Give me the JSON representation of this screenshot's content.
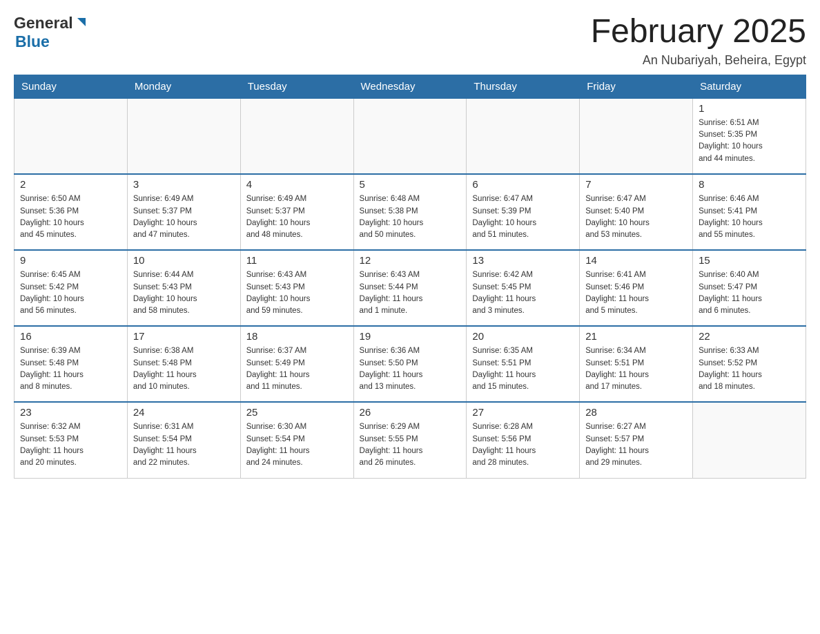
{
  "header": {
    "logo_general": "General",
    "logo_blue": "Blue",
    "title": "February 2025",
    "location": "An Nubariyah, Beheira, Egypt"
  },
  "days_of_week": [
    "Sunday",
    "Monday",
    "Tuesday",
    "Wednesday",
    "Thursday",
    "Friday",
    "Saturday"
  ],
  "weeks": [
    {
      "days": [
        {
          "num": "",
          "info": ""
        },
        {
          "num": "",
          "info": ""
        },
        {
          "num": "",
          "info": ""
        },
        {
          "num": "",
          "info": ""
        },
        {
          "num": "",
          "info": ""
        },
        {
          "num": "",
          "info": ""
        },
        {
          "num": "1",
          "info": "Sunrise: 6:51 AM\nSunset: 5:35 PM\nDaylight: 10 hours\nand 44 minutes."
        }
      ]
    },
    {
      "days": [
        {
          "num": "2",
          "info": "Sunrise: 6:50 AM\nSunset: 5:36 PM\nDaylight: 10 hours\nand 45 minutes."
        },
        {
          "num": "3",
          "info": "Sunrise: 6:49 AM\nSunset: 5:37 PM\nDaylight: 10 hours\nand 47 minutes."
        },
        {
          "num": "4",
          "info": "Sunrise: 6:49 AM\nSunset: 5:37 PM\nDaylight: 10 hours\nand 48 minutes."
        },
        {
          "num": "5",
          "info": "Sunrise: 6:48 AM\nSunset: 5:38 PM\nDaylight: 10 hours\nand 50 minutes."
        },
        {
          "num": "6",
          "info": "Sunrise: 6:47 AM\nSunset: 5:39 PM\nDaylight: 10 hours\nand 51 minutes."
        },
        {
          "num": "7",
          "info": "Sunrise: 6:47 AM\nSunset: 5:40 PM\nDaylight: 10 hours\nand 53 minutes."
        },
        {
          "num": "8",
          "info": "Sunrise: 6:46 AM\nSunset: 5:41 PM\nDaylight: 10 hours\nand 55 minutes."
        }
      ]
    },
    {
      "days": [
        {
          "num": "9",
          "info": "Sunrise: 6:45 AM\nSunset: 5:42 PM\nDaylight: 10 hours\nand 56 minutes."
        },
        {
          "num": "10",
          "info": "Sunrise: 6:44 AM\nSunset: 5:43 PM\nDaylight: 10 hours\nand 58 minutes."
        },
        {
          "num": "11",
          "info": "Sunrise: 6:43 AM\nSunset: 5:43 PM\nDaylight: 10 hours\nand 59 minutes."
        },
        {
          "num": "12",
          "info": "Sunrise: 6:43 AM\nSunset: 5:44 PM\nDaylight: 11 hours\nand 1 minute."
        },
        {
          "num": "13",
          "info": "Sunrise: 6:42 AM\nSunset: 5:45 PM\nDaylight: 11 hours\nand 3 minutes."
        },
        {
          "num": "14",
          "info": "Sunrise: 6:41 AM\nSunset: 5:46 PM\nDaylight: 11 hours\nand 5 minutes."
        },
        {
          "num": "15",
          "info": "Sunrise: 6:40 AM\nSunset: 5:47 PM\nDaylight: 11 hours\nand 6 minutes."
        }
      ]
    },
    {
      "days": [
        {
          "num": "16",
          "info": "Sunrise: 6:39 AM\nSunset: 5:48 PM\nDaylight: 11 hours\nand 8 minutes."
        },
        {
          "num": "17",
          "info": "Sunrise: 6:38 AM\nSunset: 5:48 PM\nDaylight: 11 hours\nand 10 minutes."
        },
        {
          "num": "18",
          "info": "Sunrise: 6:37 AM\nSunset: 5:49 PM\nDaylight: 11 hours\nand 11 minutes."
        },
        {
          "num": "19",
          "info": "Sunrise: 6:36 AM\nSunset: 5:50 PM\nDaylight: 11 hours\nand 13 minutes."
        },
        {
          "num": "20",
          "info": "Sunrise: 6:35 AM\nSunset: 5:51 PM\nDaylight: 11 hours\nand 15 minutes."
        },
        {
          "num": "21",
          "info": "Sunrise: 6:34 AM\nSunset: 5:51 PM\nDaylight: 11 hours\nand 17 minutes."
        },
        {
          "num": "22",
          "info": "Sunrise: 6:33 AM\nSunset: 5:52 PM\nDaylight: 11 hours\nand 18 minutes."
        }
      ]
    },
    {
      "days": [
        {
          "num": "23",
          "info": "Sunrise: 6:32 AM\nSunset: 5:53 PM\nDaylight: 11 hours\nand 20 minutes."
        },
        {
          "num": "24",
          "info": "Sunrise: 6:31 AM\nSunset: 5:54 PM\nDaylight: 11 hours\nand 22 minutes."
        },
        {
          "num": "25",
          "info": "Sunrise: 6:30 AM\nSunset: 5:54 PM\nDaylight: 11 hours\nand 24 minutes."
        },
        {
          "num": "26",
          "info": "Sunrise: 6:29 AM\nSunset: 5:55 PM\nDaylight: 11 hours\nand 26 minutes."
        },
        {
          "num": "27",
          "info": "Sunrise: 6:28 AM\nSunset: 5:56 PM\nDaylight: 11 hours\nand 28 minutes."
        },
        {
          "num": "28",
          "info": "Sunrise: 6:27 AM\nSunset: 5:57 PM\nDaylight: 11 hours\nand 29 minutes."
        },
        {
          "num": "",
          "info": ""
        }
      ]
    }
  ],
  "colors": {
    "header_bg": "#2c6ea5",
    "header_text": "#ffffff",
    "border": "#cccccc",
    "text": "#333333"
  }
}
